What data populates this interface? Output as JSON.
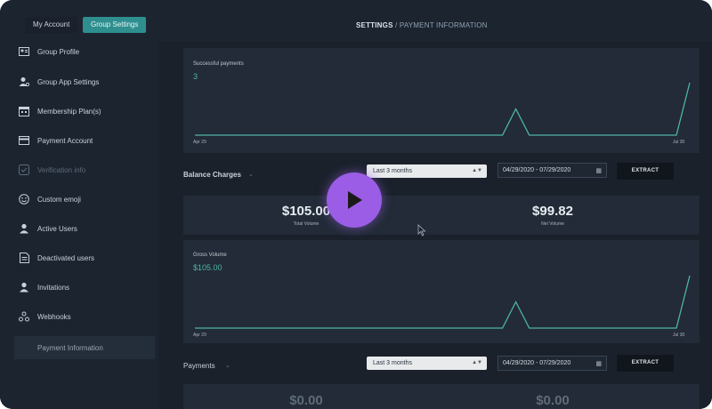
{
  "tabs": {
    "my_account": "My Account",
    "group_settings": "Group Settings"
  },
  "title": {
    "section": "SETTINGS",
    "separator": " / ",
    "page": "PAYMENT INFORMATION"
  },
  "sidebar": {
    "items": [
      {
        "label": "Group Profile",
        "icon": "id-card-icon"
      },
      {
        "label": "Group App Settings",
        "icon": "user-gear-icon"
      },
      {
        "label": "Membership Plan(s)",
        "icon": "calendar-icon"
      },
      {
        "label": "Payment Account",
        "icon": "credit-card-icon"
      },
      {
        "label": "Verification info",
        "icon": "badge-icon",
        "disabled": true
      },
      {
        "label": "Custom emoji",
        "icon": "smiley-icon"
      },
      {
        "label": "Active Users",
        "icon": "user-icon"
      },
      {
        "label": "Deactivated users",
        "icon": "document-icon"
      },
      {
        "label": "Invitations",
        "icon": "user-plus-icon"
      },
      {
        "label": "Webhooks",
        "icon": "webhook-icon"
      },
      {
        "label": "Payment Information",
        "icon": "",
        "active": true
      }
    ]
  },
  "successful_payments": {
    "title": "Successful payments",
    "value": "3",
    "x_start": "Apr 29",
    "x_end": "Jul 30",
    "series": [
      0,
      0,
      0,
      0,
      0,
      0,
      0,
      0,
      0,
      0,
      0,
      0,
      0,
      0,
      0,
      0,
      0,
      0,
      0,
      0,
      0,
      0,
      0,
      0,
      1,
      0,
      0,
      0,
      0,
      0,
      0,
      0,
      0,
      0,
      0,
      0,
      0,
      2
    ]
  },
  "balance_charges": {
    "title": "Balance Charges",
    "range": "Last 3 months",
    "dates": "04/29/2020 - 07/29/2020",
    "extract": "EXTRACT",
    "total_volume": "$105.00",
    "total_volume_label": "Total Volume",
    "net_volume": "$99.82",
    "net_volume_label": "Net Volume"
  },
  "gross_volume": {
    "title": "Gross Volume",
    "value": "$105.00",
    "x_start": "Apr 29",
    "x_end": "Jul 30",
    "series": [
      0,
      0,
      0,
      0,
      0,
      0,
      0,
      0,
      0,
      0,
      0,
      0,
      0,
      0,
      0,
      0,
      0,
      0,
      0,
      0,
      0,
      0,
      0,
      0,
      1,
      0,
      0,
      0,
      0,
      0,
      0,
      0,
      0,
      0,
      0,
      0,
      0,
      2
    ]
  },
  "payments": {
    "title": "Payments",
    "range": "Last 3 months",
    "dates": "04/29/2020 - 07/29/2020",
    "extract": "EXTRACT",
    "value_left": "$0.00",
    "value_right": "$0.00"
  },
  "colors": {
    "accent": "#2f8f8f",
    "line": "#4fb3a8",
    "play": "#9b5de5"
  }
}
